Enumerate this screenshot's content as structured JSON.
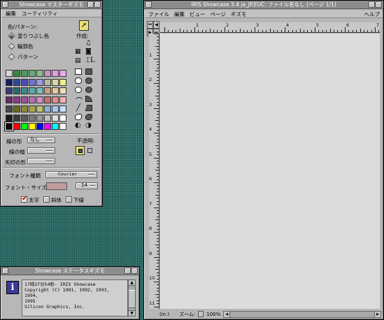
{
  "master": {
    "title": "Showcase マスターギズモ",
    "menu": [
      "編集",
      "ユーティリティ"
    ],
    "color_label": "色/パターン:",
    "fill_label": "塗りつぶし色",
    "border_label": "輪郭色",
    "pattern_label": "パターン",
    "create_label": "作成:",
    "line_style_label": "線の形",
    "line_style_value": "なし",
    "line_width_label": "線の幅",
    "arrow_label": "矢印の形",
    "opacity_label": "不透明:",
    "font_type_label": "フォント種類",
    "font_type_value": "Courier",
    "font_size_label": "フォント・サイズ",
    "font_size_value": "14",
    "bold_label": "太字",
    "italic_label": "斜体",
    "underline_label": "下線",
    "palette": [
      "#d8d8d8",
      "#3a8a3a",
      "#4aa060",
      "#6aaa78",
      "#8cbc8c",
      "#c894c8",
      "#e0a0e0",
      "#f0a8f0",
      "#1a1a6a",
      "#2a4a9a",
      "#4a4ab8",
      "#7070d0",
      "#9a9ae8",
      "#b8b8a0",
      "#d8d8a8",
      "#f0f088",
      "#3a3a7a",
      "#2a6a6a",
      "#3a8a8a",
      "#5aa8a8",
      "#78c0c0",
      "#c8a080",
      "#e8c898",
      "#f0e0b0",
      "#6a2a6a",
      "#8a3a8a",
      "#a050a0",
      "#b870b8",
      "#d090d0",
      "#c87070",
      "#e09090",
      "#f8b0b0",
      "#484848",
      "#6a6a2a",
      "#8a8a3a",
      "#a8a850",
      "#c0c070",
      "#8ab0d8",
      "#a8c8f0",
      "#c8e0ff",
      "#1a1a1a",
      "#3a3a3a",
      "#5a5a5a",
      "#7a7a7a",
      "#9a9a9a",
      "#c0c0c0",
      "#e0e0e0",
      "#ffffff",
      "#000000",
      "#ff0000",
      "#00ff00",
      "#ffff00",
      "#0000ff",
      "#ff00ff",
      "#00ffff",
      "#ffffff"
    ]
  },
  "status": {
    "title": "Showcase ステータスギズモ",
    "icon": "info-icon",
    "lines": [
      "17時27分54秒- IRIS Showcase",
      "Copyright (C)  1991, 1992, 1993, 1994,",
      "1995",
      "Silicon Graphics, Inc."
    ]
  },
  "main": {
    "title": "IRIS Showcase 3.4 ja_JP.EUC: ファイル名なし (ページ 1/1)",
    "menu": [
      "ファイル",
      "編集",
      "ビュー",
      "ページ",
      "ギズモ"
    ],
    "help": "ヘルプ",
    "units": "(in.)",
    "zoom_label": "ズーム:",
    "zoom_value": "100%",
    "ruler_h": [
      "1",
      "2",
      "3",
      "4",
      "5",
      "6",
      "7"
    ],
    "ruler_v": [
      "1",
      "2",
      "3",
      "4",
      "5",
      "6",
      "7",
      "8",
      "9",
      "10",
      "11"
    ]
  }
}
